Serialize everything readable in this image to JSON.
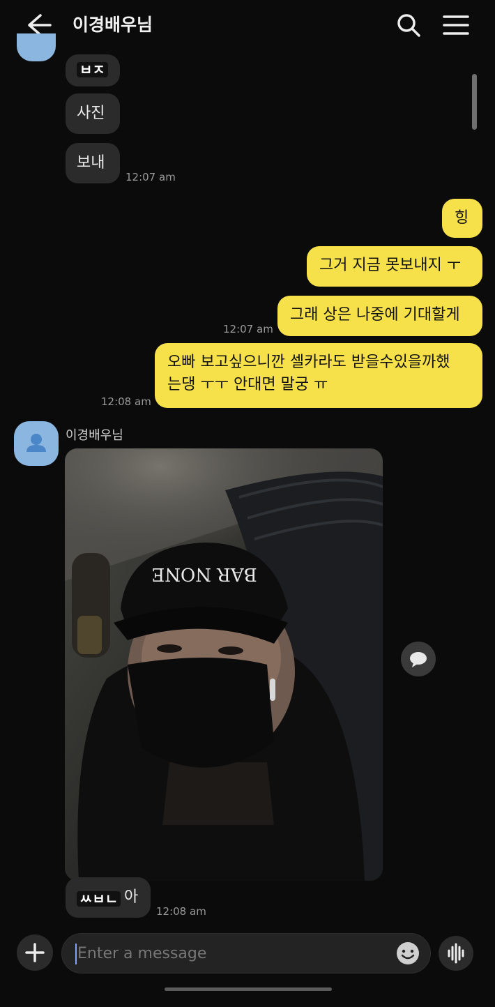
{
  "header": {
    "title": "이경배우님",
    "back_icon": "arrow-left-icon",
    "search_icon": "search-icon",
    "menu_icon": "hamburger-menu-icon"
  },
  "messages": {
    "in_1": {
      "text": "ㅂㅈ"
    },
    "in_2": {
      "text": "사진"
    },
    "in_3": {
      "text": "보내",
      "time": "12:07 am"
    },
    "out_1": {
      "text": "힝"
    },
    "out_2": {
      "text": "그거 지금 못보내지 ㅜ"
    },
    "out_3": {
      "text": "그래 상은 나중에 기대할게",
      "time": "12:07 am"
    },
    "out_4": {
      "line1": "오빠 보고싶으니깐 셀카라도 받을수있을까했",
      "line2": "는댕 ㅜㅜ 안대면 말궁 ㅠ",
      "time": "12:08 am"
    },
    "sender": {
      "name": "이경배우님"
    },
    "photo": {
      "cap_text": "BAR NONE"
    },
    "in_4": {
      "text": "아",
      "overlay": "ㅆㅂㄴ",
      "time": "12:08 am"
    }
  },
  "composer": {
    "placeholder": "Enter a message",
    "plus_icon": "plus-icon",
    "emoji_icon": "emoji-icon",
    "voice_icon": "voice-waveform-icon"
  },
  "colors": {
    "outgoing_bubble": "#f7e14a",
    "incoming_bubble": "#2b2b2b",
    "avatar": "#8bb6df",
    "background": "#0b0b0b"
  }
}
